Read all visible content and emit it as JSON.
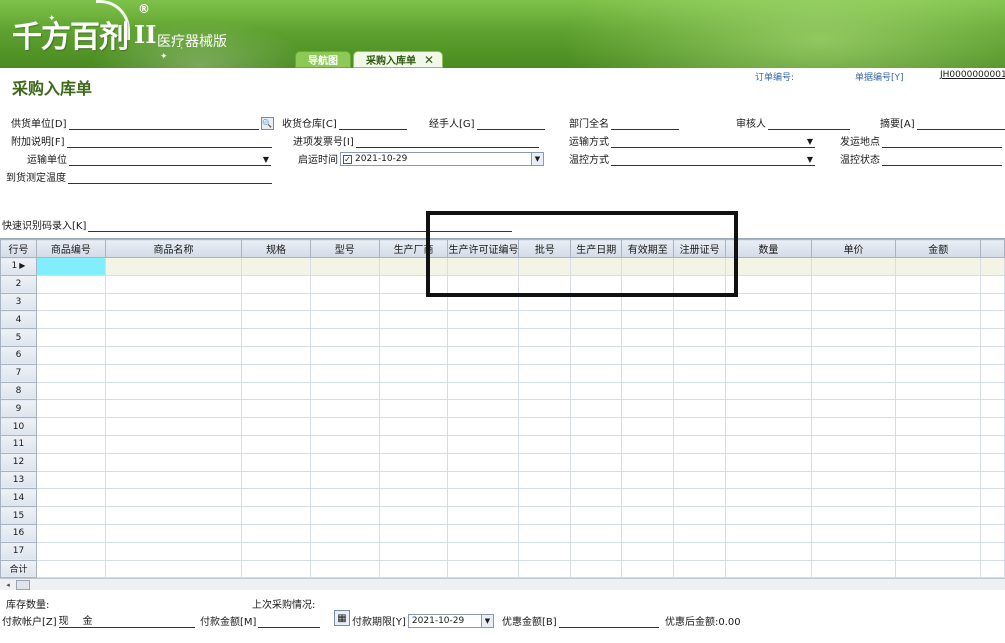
{
  "app": {
    "logo_text": "千方百剂",
    "logo_edition": "II",
    "logo_reg": "®",
    "logo_subtitle": "医疗器械版"
  },
  "tabs": [
    {
      "label": "导航图"
    },
    {
      "label": "采购入库单",
      "close": "✕"
    }
  ],
  "page": {
    "title": "采购入库单",
    "order_no_label": "订单编号:",
    "bill_no_label": "单据编号[Y]",
    "bill_no_value": "JH0000000001"
  },
  "form": {
    "supplier_label": "供货单位[D]",
    "warehouse_label": "收货仓库[C]",
    "handler_label": "经手人[G]",
    "dept_label": "部门全名",
    "reviewer_label": "审核人",
    "summary_label": "摘要[A]",
    "note_label": "附加说明[F]",
    "invoice_label": "进项发票号[I]",
    "transport_mode_label": "运输方式",
    "ship_place_label": "发运地点",
    "carrier_label": "运输单位",
    "depart_time_label": "启运时间",
    "depart_time_value": "2021-10-29",
    "temp_mode_label": "温控方式",
    "temp_state_label": "温控状态",
    "arrival_temp_label": "到货测定温度",
    "quick_label": "快速识别码录入[K]"
  },
  "grid": {
    "columns": [
      "行号",
      "商品编号",
      "商品名称",
      "规格",
      "型号",
      "生产厂商",
      "生产许可证编号",
      "批号",
      "生产日期",
      "有效期至",
      "注册证号",
      "数量",
      "单价",
      "金额",
      ""
    ],
    "rows": [
      "1",
      "2",
      "3",
      "4",
      "5",
      "6",
      "7",
      "8",
      "9",
      "10",
      "11",
      "12",
      "13",
      "14",
      "15",
      "16",
      "17"
    ],
    "total_label": "合计"
  },
  "bottom": {
    "stock_label": "库存数量:",
    "last_purchase_label": "上次采购情况:",
    "pay_account_label": "付款帐户[Z]",
    "pay_account_value": "现金",
    "pay_amount_label": "付款金额[M]",
    "pay_term_label": "付款期限[Y]",
    "pay_term_value": "2021-10-29",
    "discount_label": "优惠金额[B]",
    "after_discount_label": "优惠后金额:",
    "after_discount_value": "0.00"
  }
}
